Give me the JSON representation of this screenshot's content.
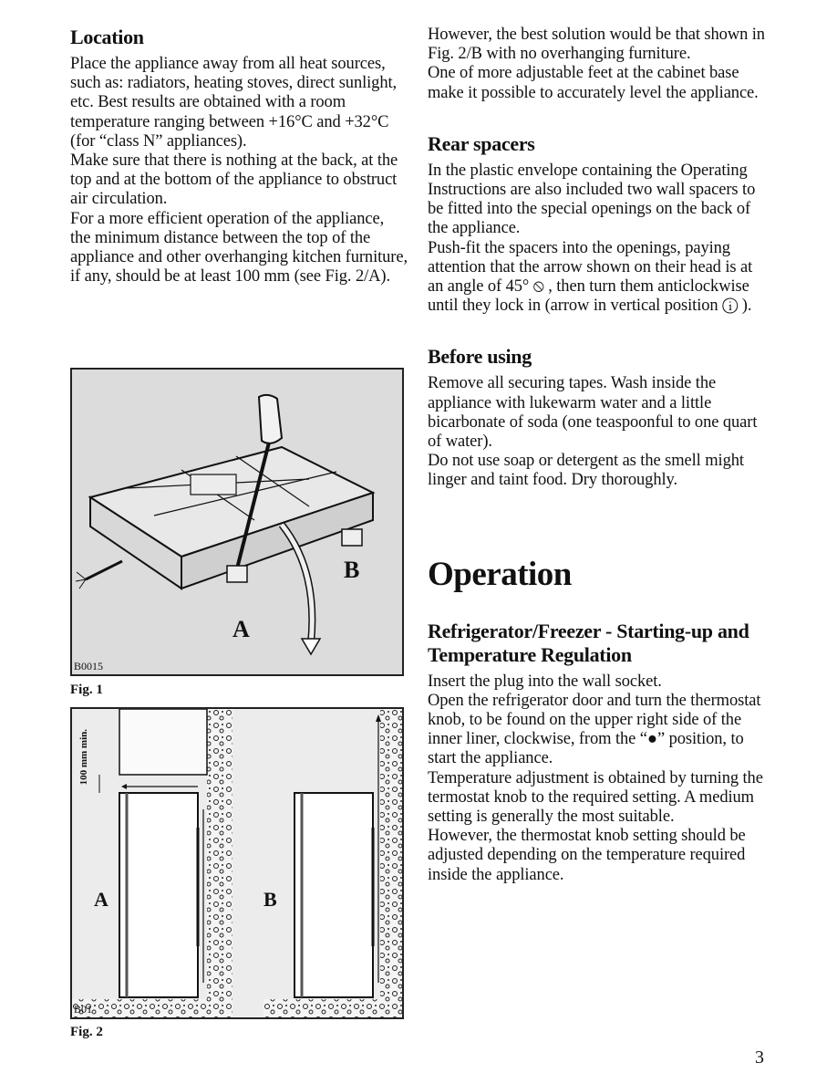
{
  "left": {
    "location": {
      "heading": "Location",
      "paragraphs": [
        "Place the appliance away from all heat sources, such as: radiators, heating stoves, direct sunlight, etc. Best results are obtained with a room temperature ranging between +16°C and +32°C (for “class N” appliances).",
        "Make sure that there is nothing at the back, at the top and at the bottom of the appliance to obstruct air circulation.",
        "For a more efficient operation of the appliance, the minimum distance between the top of the appliance and other overhanging kitchen furniture, if any, should be at least 100 mm (see Fig. 2/A)."
      ]
    },
    "fig1": {
      "caption": "Fig. 1",
      "code": "B0015",
      "label_a": "A",
      "label_b": "B"
    },
    "fig2": {
      "caption": "Fig. 2",
      "code": "B01",
      "label_a": "A",
      "label_b": "B",
      "distance_label": "100 mm min."
    }
  },
  "right": {
    "intro": {
      "paragraphs": [
        "However, the best solution would be that shown in Fig. 2/B with no overhanging furniture.",
        "One of more adjustable feet at the cabinet base make it possible to accurately level the appliance."
      ]
    },
    "rear_spacers": {
      "heading": "Rear spacers",
      "paragraphs": [
        "In the plastic envelope containing the Operating Instructions are also included two wall spacers to be fitted into the special openings on the back of the appliance.",
        "Push-fit the spacers into the openings, paying attention that the arrow shown on their head is at an angle of 45° ⦸ , then turn them anticlockwise until they lock in (arrow in vertical position ⓘ )."
      ]
    },
    "before_using": {
      "heading": "Before using",
      "paragraphs": [
        "Remove all securing tapes. Wash inside the appliance with lukewarm water and a little bicarbonate of soda (one teaspoonful to one quart of water).",
        "Do not use soap or detergent as the smell might linger and taint food. Dry thoroughly."
      ]
    },
    "operation": {
      "title": "Operation",
      "subheading": "Refrigerator/Freezer - Starting-up and Temperature Regulation",
      "paragraphs": [
        "Insert the plug into the wall socket.",
        "Open the refrigerator door and turn the thermostat knob, to be found on the upper right side of the inner liner, clockwise, from the “●” position, to start the appliance.",
        "Temperature adjustment is obtained by turning the termostat knob to the required setting. A medium setting is generally the most suitable.",
        "However, the thermostat knob setting should be adjusted depending on the temperature required inside the appliance."
      ]
    }
  },
  "page_number": "3"
}
